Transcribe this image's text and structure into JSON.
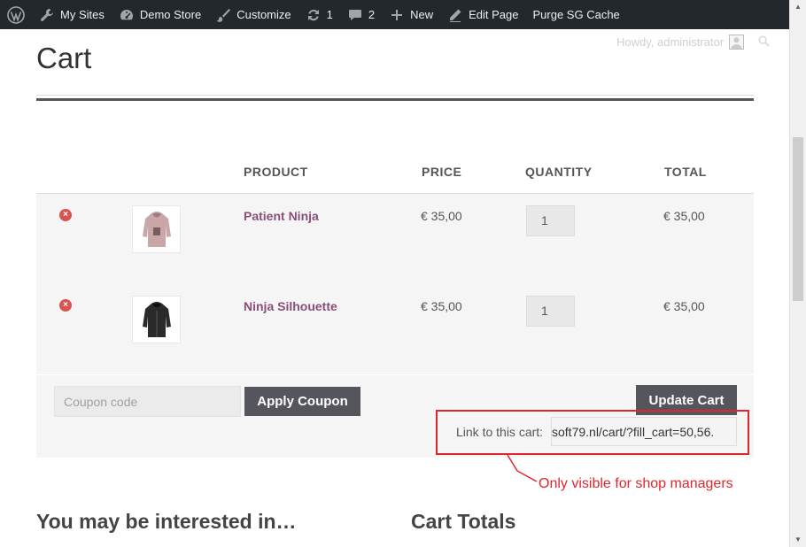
{
  "adminbar": {
    "items": [
      {
        "label": "My Sites",
        "icon": "wrench-icon"
      },
      {
        "label": "Demo Store",
        "icon": "dashboard-icon"
      },
      {
        "label": "Customize",
        "icon": "brush-icon"
      },
      {
        "label": "1",
        "icon": "refresh-icon"
      },
      {
        "label": "2",
        "icon": "comment-icon"
      },
      {
        "label": "New",
        "icon": "plus-icon"
      },
      {
        "label": "Edit Page",
        "icon": "pencil-icon"
      },
      {
        "label": "Purge SG Cache",
        "icon": ""
      }
    ],
    "background": "#23282d"
  },
  "howdy": "Howdy, administrator",
  "page": {
    "title": "Cart"
  },
  "cart": {
    "headers": [
      "PRODUCT",
      "PRICE",
      "QUANTITY",
      "TOTAL"
    ],
    "items": [
      {
        "name": "Patient Ninja",
        "price": "€ 35,00",
        "quantity": "1",
        "total": "€ 35,00"
      },
      {
        "name": "Ninja Silhouette",
        "price": "€ 35,00",
        "quantity": "1",
        "total": "€ 35,00"
      }
    ],
    "coupon_placeholder": "Coupon code",
    "apply_coupon_label": "Apply Coupon",
    "update_cart_label": "Update Cart",
    "cart_link_label": "Link to this cart:",
    "cart_link_value": ".soft79.nl/cart/?fill_cart=50,56"
  },
  "annotation": {
    "text": "Only visible for shop managers",
    "color": "#e0252d"
  },
  "sections": {
    "interested": "You may be interested in…",
    "totals": "Cart Totals"
  },
  "colors": {
    "product_link": "#8a4e7b",
    "button": "#55555e",
    "remove": "#d9534f"
  }
}
